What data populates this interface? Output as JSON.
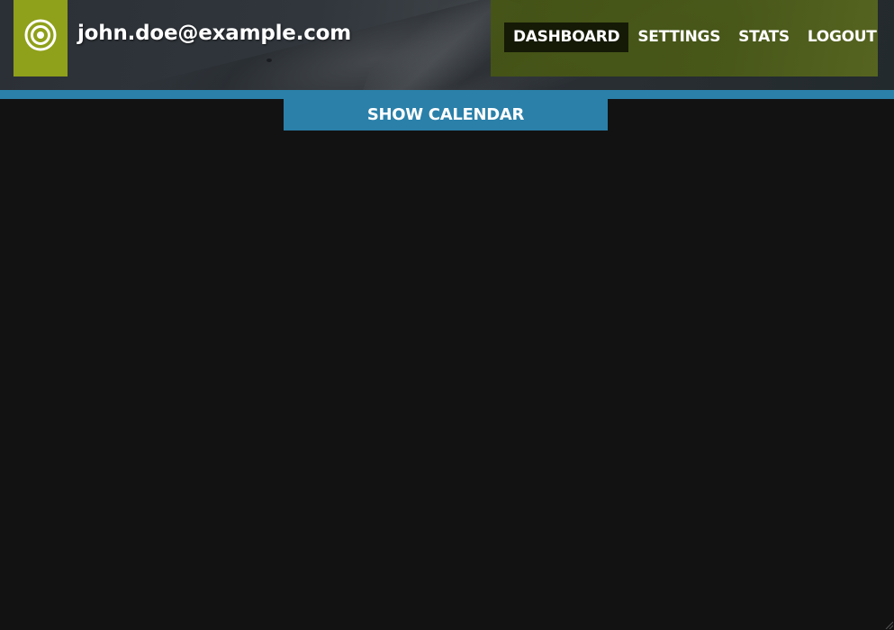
{
  "header": {
    "user_email": "john.doe@example.com",
    "logo_icon": "target-icon",
    "logo_color": "#8fa01a"
  },
  "nav": {
    "items": [
      {
        "label": "DASHBOARD",
        "active": true
      },
      {
        "label": "SETTINGS",
        "active": false
      },
      {
        "label": "STATS",
        "active": false
      },
      {
        "label": "LOGOUT",
        "active": false
      }
    ]
  },
  "main": {
    "calendar_button_label": "SHOW CALENDAR"
  },
  "colors": {
    "accent_blue": "#2a80a9",
    "accent_green": "#8fa01a",
    "background": "#121212"
  }
}
